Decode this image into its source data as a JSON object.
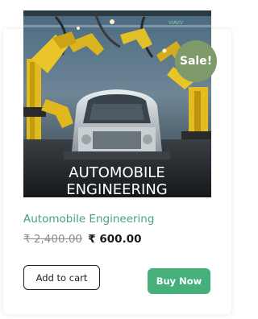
{
  "product": {
    "image_caption_line1": "AUTOMOBILE",
    "image_caption_line2": "ENGINEERING",
    "watermark": "VIAVV",
    "sale_badge": "Sale!",
    "title": "Automobile Engineering",
    "old_price": "₹ 2,400.00",
    "new_price": "₹ 600.00"
  },
  "actions": {
    "add_to_cart": "Add to cart",
    "buy_now": "Buy Now"
  },
  "colors": {
    "title": "#4aa27a",
    "sale_badge": "#7e9a6a",
    "buy_now": "#45b07a"
  }
}
